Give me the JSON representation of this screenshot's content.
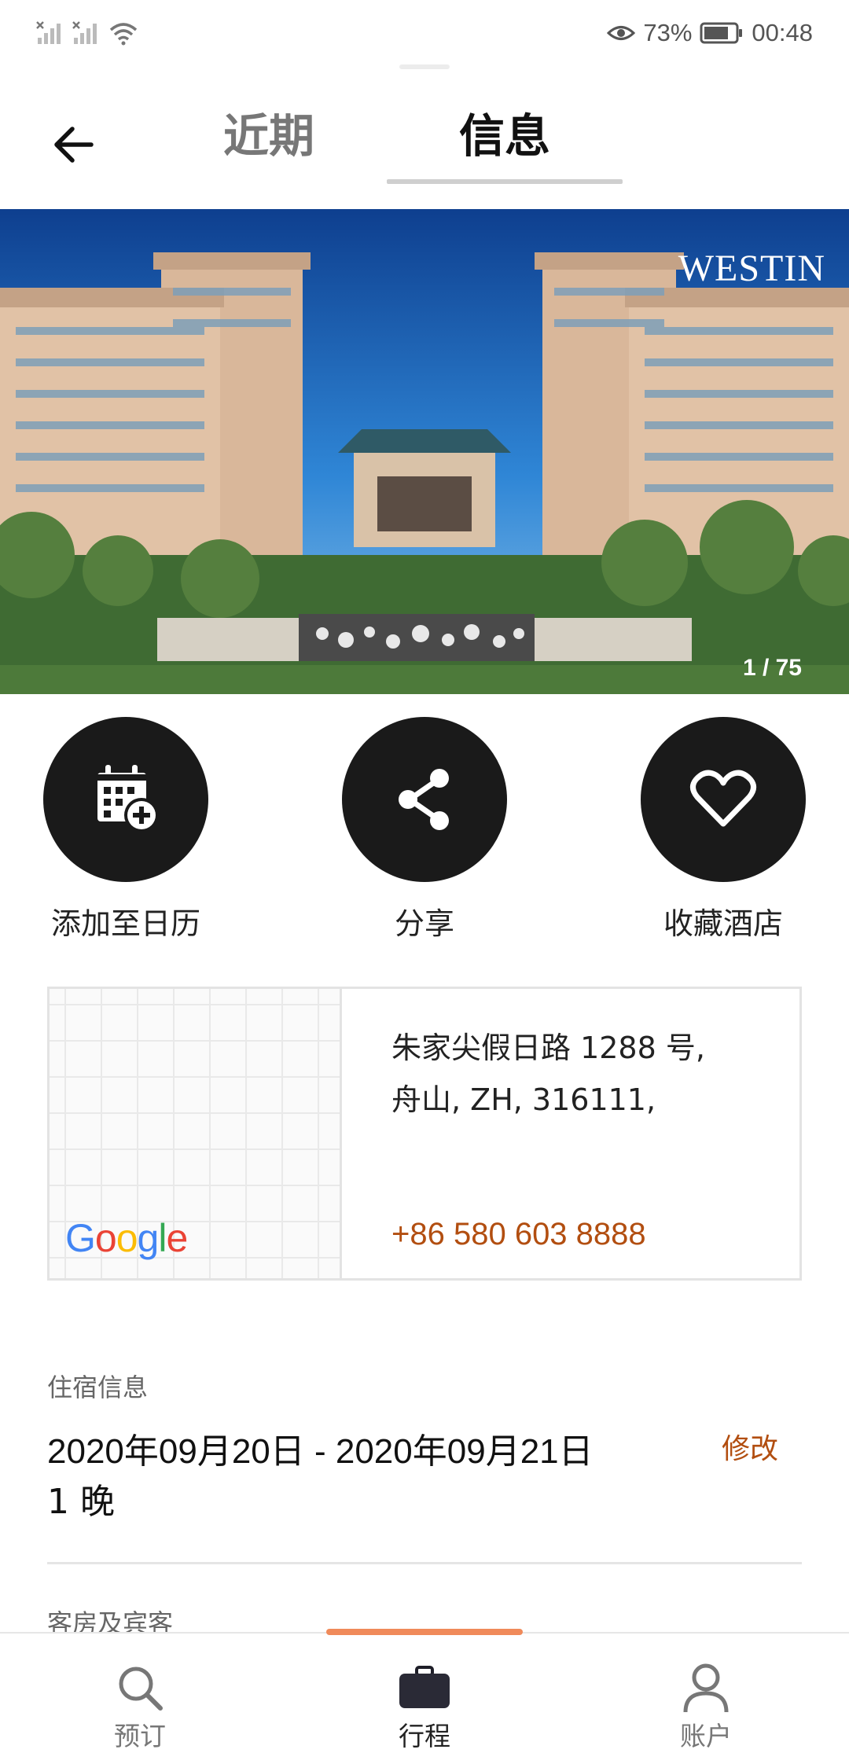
{
  "status_bar": {
    "battery": "73%",
    "time": "00:48"
  },
  "header": {
    "tabs": [
      {
        "label": "近期",
        "active": false
      },
      {
        "label": "信息",
        "active": true
      }
    ]
  },
  "hero": {
    "brand": "WESTIN",
    "photo_counter": "1 / 75"
  },
  "actions": [
    {
      "label": "添加至日历",
      "icon": "calendar-add-icon"
    },
    {
      "label": "分享",
      "icon": "share-icon"
    },
    {
      "label": "收藏酒店",
      "icon": "heart-icon"
    }
  ],
  "location": {
    "address_line1": "朱家尖假日路 1288 号,",
    "address_line2": "舟山, ZH, 316111,",
    "phone": "+86 580 603 8888",
    "map_logo": "Google"
  },
  "stay": {
    "title": "住宿信息",
    "dates": "2020年09月20日 - 2020年09月21日",
    "nights": "1 晚",
    "modify_label": "修改"
  },
  "rooms": {
    "title": "客房及宾客"
  },
  "bottom_nav": [
    {
      "label": "预订",
      "icon": "search-icon",
      "active": false
    },
    {
      "label": "行程",
      "icon": "briefcase-icon",
      "active": true
    },
    {
      "label": "账户",
      "icon": "person-icon",
      "active": false
    }
  ],
  "colors": {
    "accent": "#b24e10",
    "nav_indicator": "#f08a5a",
    "action_circle": "#1a1a1a"
  }
}
